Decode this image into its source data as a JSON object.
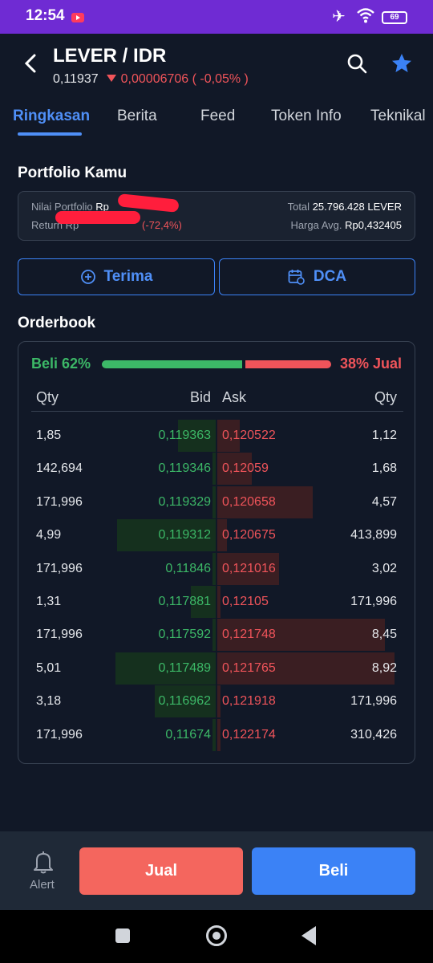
{
  "status_bar": {
    "time": "12:54",
    "battery": "69"
  },
  "header": {
    "title": "LEVER / IDR",
    "price": "0,11937",
    "change": "0,00006706 ( -0,05% )"
  },
  "tabs": [
    "Ringkasan",
    "Berita",
    "Feed",
    "Token Info",
    "Teknikal"
  ],
  "portfolio": {
    "title": "Portfolio Kamu",
    "nilai_label": "Nilai Portfolio",
    "nilai_value": "Rp",
    "return_label": "Return",
    "return_value": "Rp",
    "return_pct": "(-72,4%)",
    "total_label": "Total",
    "total_value": "25.796.428 LEVER",
    "avg_label": "Harga Avg.",
    "avg_value": "Rp0,432405"
  },
  "actions": {
    "receive_label": "Terima",
    "dca_label": "DCA"
  },
  "orderbook": {
    "title": "Orderbook",
    "buy_ratio_label": "Beli 62%",
    "sell_ratio_label": "38% Jual",
    "buy_ratio": 0.62,
    "headers": {
      "qty_left": "Qty",
      "bid": "Bid",
      "ask": "Ask",
      "qty_right": "Qty"
    },
    "rows": [
      {
        "qty_bid": "1,85",
        "bid": "0,119363",
        "ask": "0,120522",
        "qty_ask": "1,12",
        "bid_depth": 0.38,
        "ask_depth": 0.23
      },
      {
        "qty_bid": "142,694",
        "bid": "0,119346",
        "ask": "0,12059",
        "qty_ask": "1,68",
        "bid_depth": 0.03,
        "ask_depth": 0.35
      },
      {
        "qty_bid": "171,996",
        "bid": "0,119329",
        "ask": "0,120658",
        "qty_ask": "4,57",
        "bid_depth": 0.03,
        "ask_depth": 0.97
      },
      {
        "qty_bid": "4,99",
        "bid": "0,119312",
        "ask": "0,120675",
        "qty_ask": "413,899",
        "bid_depth": 1.0,
        "ask_depth": 0.1
      },
      {
        "qty_bid": "171,996",
        "bid": "0,11846",
        "ask": "0,121016",
        "qty_ask": "3,02",
        "bid_depth": 0.03,
        "ask_depth": 0.63
      },
      {
        "qty_bid": "1,31",
        "bid": "0,117881",
        "ask": "0,12105",
        "qty_ask": "171,996",
        "bid_depth": 0.25,
        "ask_depth": 0.03
      },
      {
        "qty_bid": "171,996",
        "bid": "0,117592",
        "ask": "0,121748",
        "qty_ask": "8,45",
        "bid_depth": 0.03,
        "ask_depth": 1.7
      },
      {
        "qty_bid": "5,01",
        "bid": "0,117489",
        "ask": "0,121765",
        "qty_ask": "8,92",
        "bid_depth": 1.02,
        "ask_depth": 1.8
      },
      {
        "qty_bid": "3,18",
        "bid": "0,116962",
        "ask": "0,121918",
        "qty_ask": "171,996",
        "bid_depth": 0.62,
        "ask_depth": 0.03
      },
      {
        "qty_bid": "171,996",
        "bid": "0,11674",
        "ask": "0,122174",
        "qty_ask": "310,426",
        "bid_depth": 0.03,
        "ask_depth": 0.03
      }
    ]
  },
  "bottom": {
    "alert_label": "Alert",
    "sell_label": "Jual",
    "buy_label": "Beli"
  },
  "colors": {
    "accent": "#4f8ff7",
    "buy": "#3cb867",
    "sell": "#f0545a",
    "background": "#111827"
  }
}
